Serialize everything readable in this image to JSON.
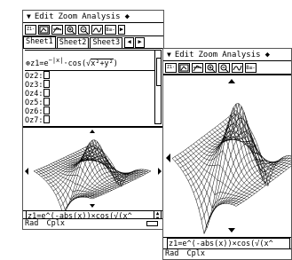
{
  "screen1": {
    "menu": [
      "Edit",
      "Zoom",
      "Analysis"
    ],
    "toolbar_labels": [
      "Z1-Z8",
      "8≡-"
    ],
    "tabs": [
      "Sheet1",
      "Sheet2",
      "Sheet3"
    ],
    "equations": [
      {
        "label": "Oz1=",
        "value": "e^-|x| · cos(√(x²+y²))"
      },
      {
        "label": "Oz2:",
        "value": ""
      },
      {
        "label": "Oz3:",
        "value": ""
      },
      {
        "label": "Oz4:",
        "value": ""
      },
      {
        "label": "Oz5:",
        "value": ""
      },
      {
        "label": "Oz6:",
        "value": ""
      },
      {
        "label": "Oz7:",
        "value": ""
      }
    ],
    "formula_parts": {
      "prefix": "z1=e",
      "exp": "−|x|",
      "mid": "·cos",
      "root": "x²+y²"
    },
    "command_line": "z1=e^(-abs(x))×cos(√(x^",
    "status": {
      "mode": "Rad",
      "format": "Cplx"
    }
  },
  "screen2": {
    "menu": [
      "Edit",
      "Zoom",
      "Analysis"
    ],
    "toolbar_labels": [
      "Z1-Z8",
      "8≡-"
    ],
    "command_line": "z1=e^(-abs(x))×cos(√(x^",
    "status": {
      "mode": "Rad",
      "format": "Cplx"
    }
  },
  "icons": {
    "menu": "down-triangle-menu-icon",
    "diamond": "diamond-icon",
    "battery": "battery-icon"
  }
}
